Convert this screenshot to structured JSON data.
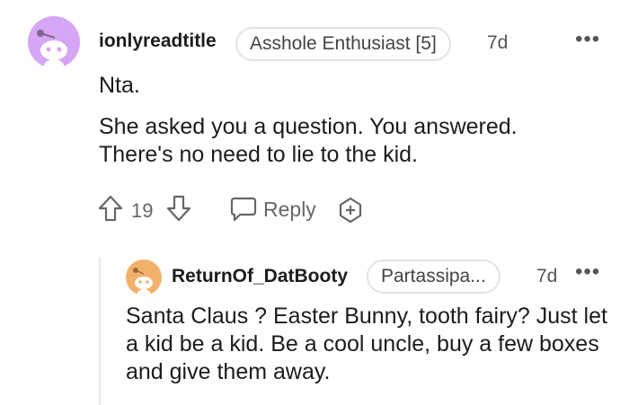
{
  "comment": {
    "username": "ionlyreadtitle",
    "flair": "Asshole Enthusiast [5]",
    "time": "7d",
    "paragraphs": [
      "Nta.",
      "She asked you a question. You answered. There's no need to lie to the kid."
    ],
    "votes": "19",
    "reply_label": "Reply"
  },
  "reply": {
    "username": "ReturnOf_DatBooty",
    "flair": "Partassipa...",
    "time": "7d",
    "text": "Santa Claus ? Easter Bunny, tooth fairy? Just let a kid be a kid. Be a cool uncle, buy a few boxes and give them away."
  },
  "icons": {
    "avatar": "snoo-avatar-icon",
    "more": "more-options-icon",
    "upvote": "upvote-arrow-icon",
    "downvote": "downvote-arrow-icon",
    "reply": "speech-bubble-icon",
    "award": "award-plus-icon"
  },
  "colors": {
    "avatar_bg_1": "#d6a5f5",
    "avatar_bg_2": "#f2b16b",
    "snoo": "#ffffff"
  }
}
